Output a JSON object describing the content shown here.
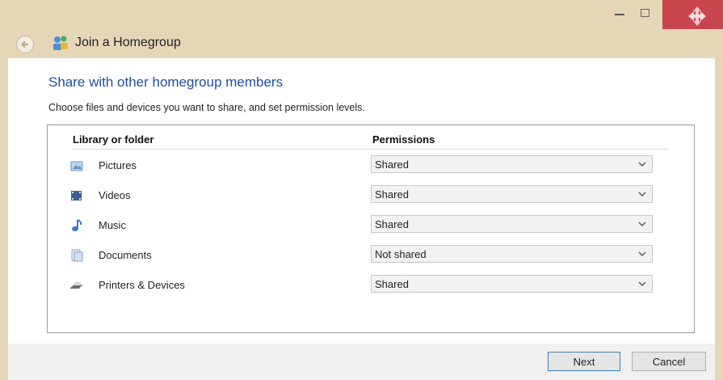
{
  "window": {
    "title": "Join a Homegroup",
    "accent_close": "#c8454e"
  },
  "main": {
    "heading": "Share with other homegroup members",
    "instruction": "Choose files and devices you want to share, and set permission levels.",
    "columns": {
      "library": "Library or folder",
      "permissions": "Permissions"
    },
    "rows": [
      {
        "label": "Pictures",
        "icon": "pictures-icon",
        "permission": "Shared"
      },
      {
        "label": "Videos",
        "icon": "videos-icon",
        "permission": "Shared"
      },
      {
        "label": "Music",
        "icon": "music-icon",
        "permission": "Shared"
      },
      {
        "label": "Documents",
        "icon": "documents-icon",
        "permission": "Not shared"
      },
      {
        "label": "Printers & Devices",
        "icon": "printer-icon",
        "permission": "Shared"
      }
    ]
  },
  "footer": {
    "next_label": "Next",
    "cancel_label": "Cancel"
  }
}
